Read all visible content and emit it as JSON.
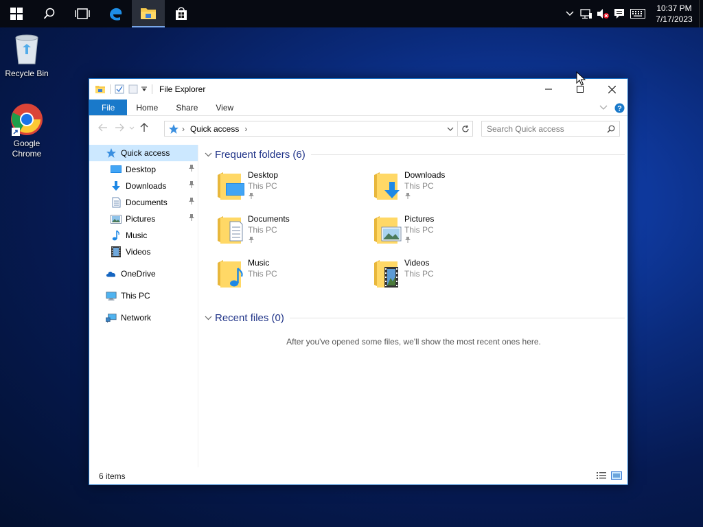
{
  "taskbar": {
    "clock_time": "10:37 PM",
    "clock_date": "7/17/2023"
  },
  "desktop": {
    "icons": [
      {
        "label": "Recycle Bin"
      },
      {
        "label": "Google Chrome"
      }
    ]
  },
  "window": {
    "title": "File Explorer",
    "ribbon_tabs": [
      "File",
      "Home",
      "Share",
      "View"
    ],
    "address": {
      "path": [
        "Quick access"
      ]
    },
    "search_placeholder": "Search Quick access",
    "nav": {
      "quick_access": "Quick access",
      "items": [
        {
          "label": "Desktop",
          "pinned": true
        },
        {
          "label": "Downloads",
          "pinned": true
        },
        {
          "label": "Documents",
          "pinned": true
        },
        {
          "label": "Pictures",
          "pinned": true
        },
        {
          "label": "Music",
          "pinned": false
        },
        {
          "label": "Videos",
          "pinned": false
        }
      ],
      "onedrive": "OneDrive",
      "this_pc": "This PC",
      "network": "Network"
    },
    "frequent": {
      "header": "Frequent folders (6)",
      "folders": [
        {
          "name": "Desktop",
          "location": "This PC",
          "pinned": true
        },
        {
          "name": "Downloads",
          "location": "This PC",
          "pinned": true
        },
        {
          "name": "Documents",
          "location": "This PC",
          "pinned": true
        },
        {
          "name": "Pictures",
          "location": "This PC",
          "pinned": true
        },
        {
          "name": "Music",
          "location": "This PC",
          "pinned": false
        },
        {
          "name": "Videos",
          "location": "This PC",
          "pinned": false
        }
      ]
    },
    "recent": {
      "header": "Recent files (0)",
      "empty_message": "After you've opened some files, we'll show the most recent ones here."
    },
    "status": "6 items"
  },
  "colors": {
    "accent": "#1979ca",
    "header_text": "#1e3287",
    "selection": "#cce8ff"
  }
}
